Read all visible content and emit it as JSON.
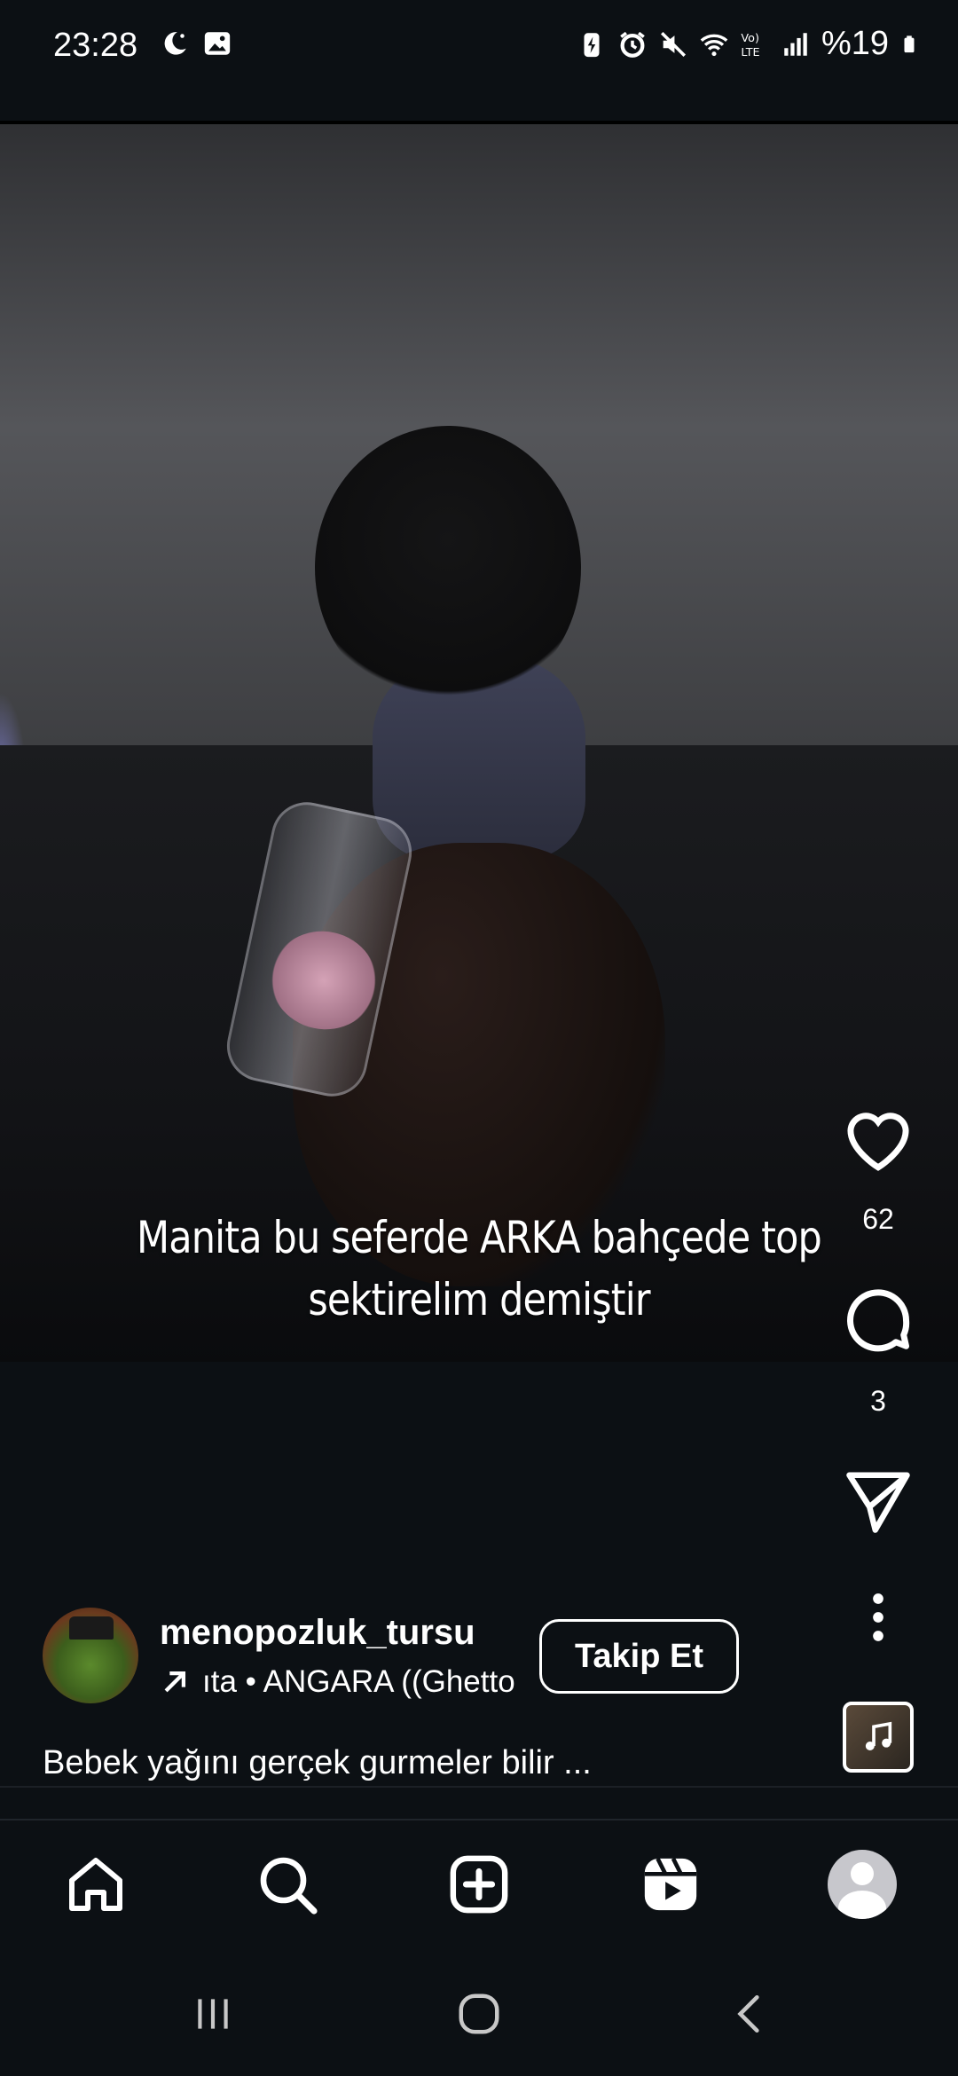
{
  "status_bar": {
    "time": "23:28",
    "battery": "%19",
    "left_icons": [
      "moon-icon",
      "image-icon"
    ],
    "right_icons": [
      "battery-saver-icon",
      "alarm-icon",
      "mute-icon",
      "wifi-icon",
      "volte-icon",
      "signal-icon",
      "battery-icon"
    ]
  },
  "post": {
    "caption_overlay_line1": "Manita bu seferde ARKA bahçede top",
    "caption_overlay_line2": "sektirelim demiştir",
    "likes": "62",
    "comments": "3",
    "author": {
      "username": "menopozluk_tursu",
      "music": "ıta • ANGARA ((Ghetto",
      "follow_label": "Takip Et"
    },
    "description": "Bebek yağını gerçek gurmeler bilir ..."
  },
  "actions": {
    "like": "heart-icon",
    "comment": "comment-icon",
    "share": "send-icon",
    "more": "more-vertical-icon",
    "audio": "music-note-icon"
  },
  "bottom_nav": [
    "home-icon",
    "search-icon",
    "create-icon",
    "reels-icon",
    "profile-avatar"
  ],
  "system_nav": [
    "recents-icon",
    "home-circle-icon",
    "back-icon"
  ],
  "colors": {
    "background": "#0c1014",
    "text": "#ffffff"
  }
}
